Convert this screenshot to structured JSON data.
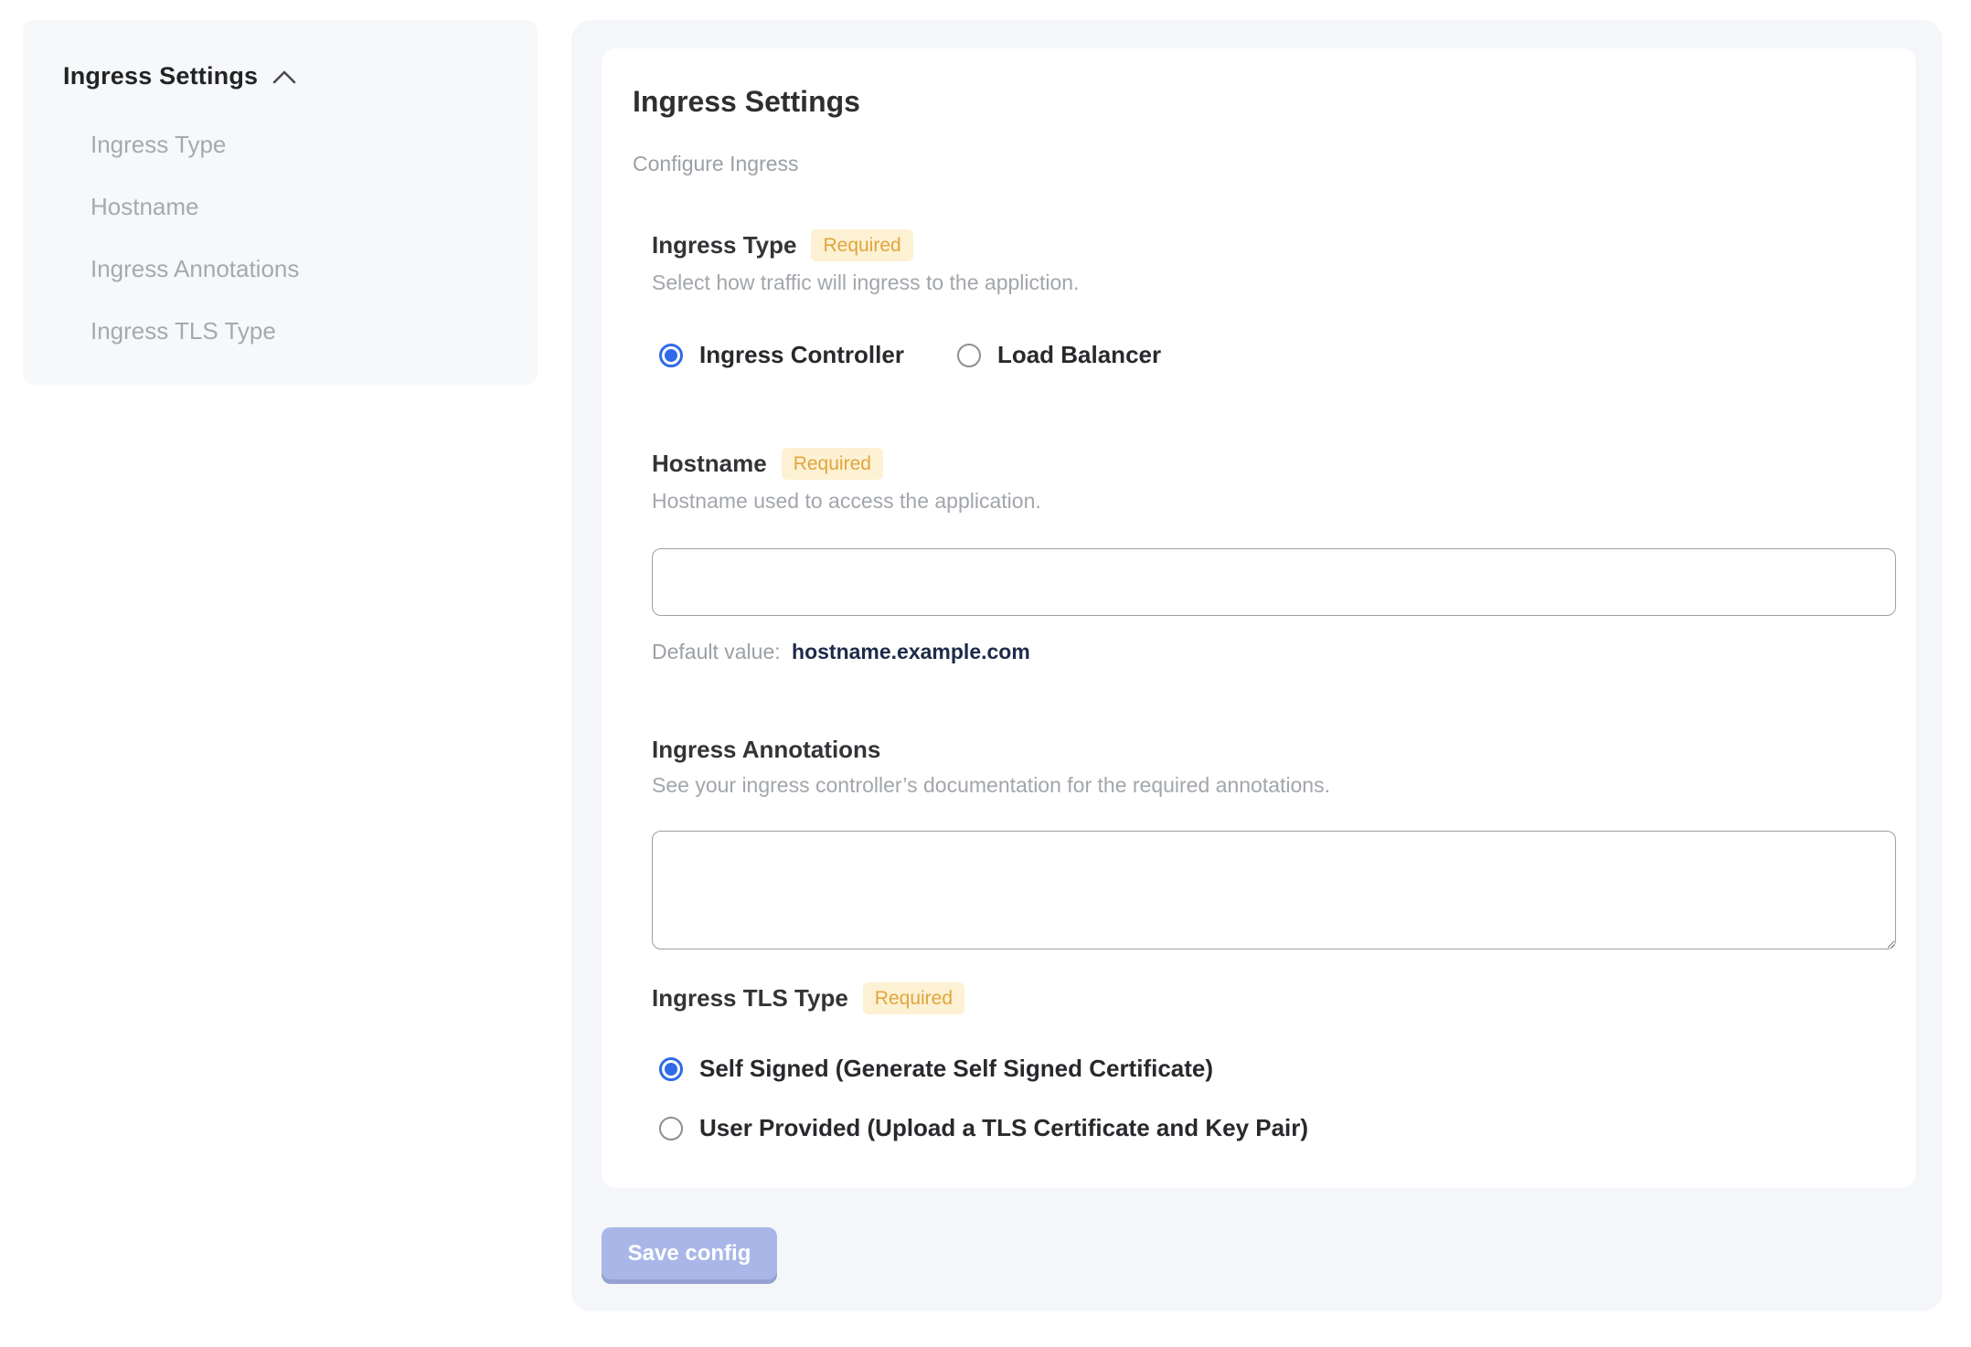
{
  "sidebar": {
    "title": "Ingress Settings",
    "items": [
      {
        "label": "Ingress Type"
      },
      {
        "label": "Hostname"
      },
      {
        "label": "Ingress Annotations"
      },
      {
        "label": "Ingress TLS Type"
      }
    ]
  },
  "panel": {
    "title": "Ingress Settings",
    "subtitle": "Configure Ingress",
    "sections": {
      "ingress_type": {
        "label": "Ingress Type",
        "required_badge": "Required",
        "description": "Select how traffic will ingress to the appliction.",
        "options": [
          {
            "label": "Ingress Controller",
            "selected": true
          },
          {
            "label": "Load Balancer",
            "selected": false
          }
        ]
      },
      "hostname": {
        "label": "Hostname",
        "required_badge": "Required",
        "description": "Hostname used to access the application.",
        "input_value": "",
        "input_placeholder": "",
        "default_prefix": "Default value:",
        "default_value": "hostname.example.com"
      },
      "annotations": {
        "label": "Ingress Annotations",
        "description": "See your ingress controller’s documentation for the required annotations.",
        "textarea_value": ""
      },
      "tls": {
        "label": "Ingress TLS Type",
        "required_badge": "Required",
        "options": [
          {
            "label": "Self Signed (Generate Self Signed Certificate)",
            "selected": true
          },
          {
            "label": "User Provided (Upload a TLS Certificate and Key Pair)",
            "selected": false
          }
        ]
      }
    },
    "save_button": "Save config"
  },
  "colors": {
    "radio_selected": "#2f6ae8",
    "badge_bg": "#fdf1d3",
    "badge_text": "#dfa63c",
    "default_value_text": "#1c2b4a",
    "save_button_bg": "#a9b7e8",
    "save_button_shadow": "#93a2cf",
    "sidebar_bg": "#f7f8f9",
    "panel_bg": "#f4f6f9"
  }
}
